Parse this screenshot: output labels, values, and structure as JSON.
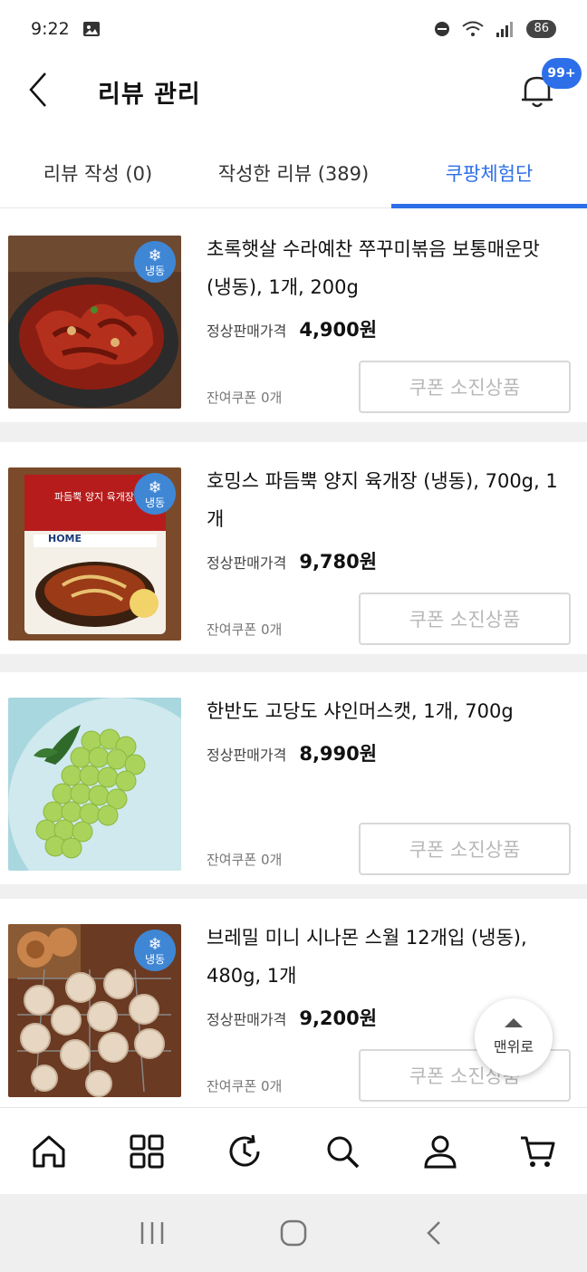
{
  "status": {
    "time": "9:22",
    "battery": "86"
  },
  "header": {
    "title": "리뷰 관리",
    "badge": "99+"
  },
  "tabs": [
    {
      "label": "리뷰 작성 (0)"
    },
    {
      "label": "작성한 리뷰 (389)"
    },
    {
      "label": "쿠팡체험단"
    }
  ],
  "products": [
    {
      "name": "초록햇살 수라예찬 쭈꾸미볶음 보통매운맛 (냉동), 1개, 200g",
      "price_label": "정상판매가격",
      "price": "4,900원",
      "coupon": "잔여쿠폰 0개",
      "button": "쿠폰 소진상품",
      "frozen_label": "냉동"
    },
    {
      "name": "호밍스 파듬뿍 양지 육개장 (냉동), 700g, 1개",
      "price_label": "정상판매가격",
      "price": "9,780원",
      "coupon": "잔여쿠폰 0개",
      "button": "쿠폰 소진상품",
      "frozen_label": "냉동",
      "package_title": "파듬뿍 양지 육개장",
      "package_brand": "HOME"
    },
    {
      "name": "한반도 고당도 샤인머스캣, 1개, 700g",
      "price_label": "정상판매가격",
      "price": "8,990원",
      "coupon": "잔여쿠폰 0개",
      "button": "쿠폰 소진상품"
    },
    {
      "name": "브레밀 미니 시나몬 스월 12개입 (냉동), 480g, 1개",
      "price_label": "정상판매가격",
      "price": "9,200원",
      "coupon": "잔여쿠폰 0개",
      "button": "쿠폰 소진상품",
      "frozen_label": "냉동"
    }
  ],
  "to_top": {
    "label": "맨위로"
  },
  "colors": {
    "accent": "#2d6fe8",
    "frozen_badge": "#3f86d4"
  },
  "bottom_nav": [
    "home-icon",
    "category-icon",
    "recent-icon",
    "search-icon",
    "my-page-icon",
    "cart-icon"
  ]
}
